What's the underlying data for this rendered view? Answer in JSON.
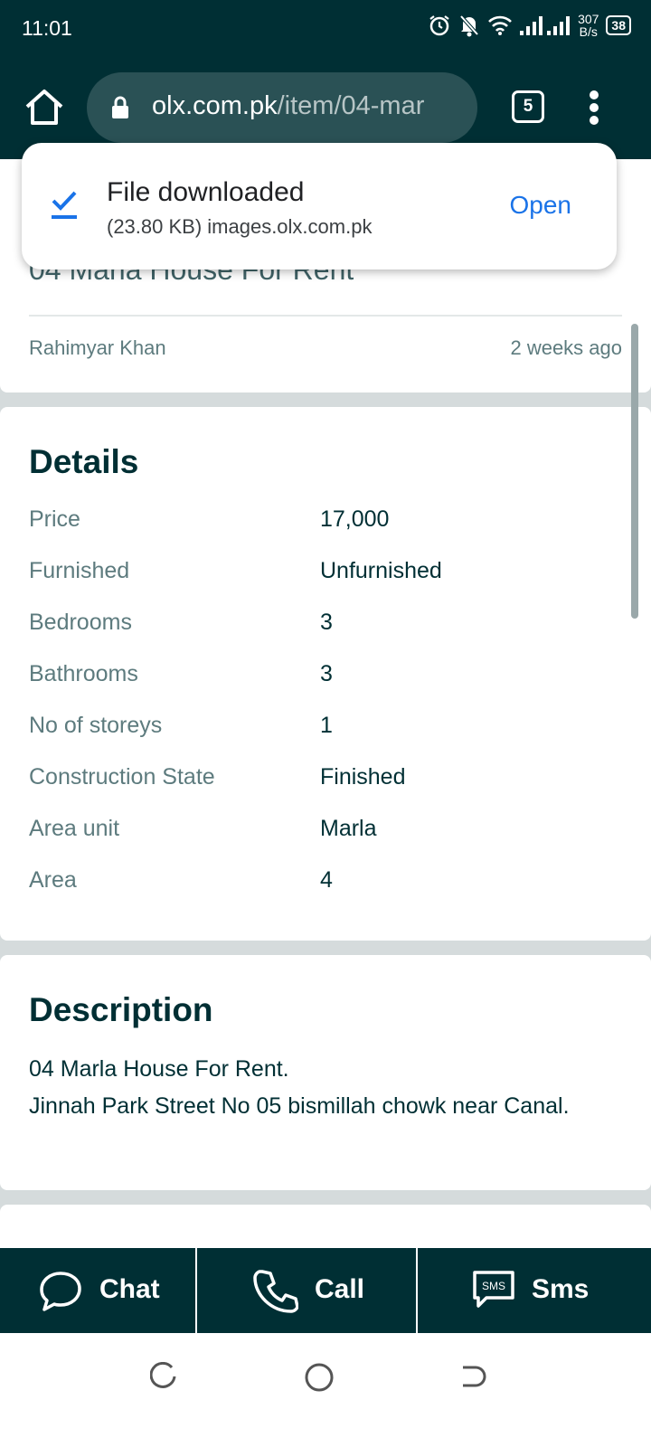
{
  "status_bar": {
    "time": "11:01",
    "net_speed_value": "307",
    "net_speed_unit": "B/s",
    "battery": "38"
  },
  "browser": {
    "url_domain": "olx.com.pk",
    "url_path": "/item/04-mar",
    "tab_count": "5"
  },
  "download": {
    "title": "File downloaded",
    "detail": "(23.80 KB) images.olx.com.pk",
    "open_label": "Open"
  },
  "ad": {
    "title": "04 Marla House For Rent",
    "location": "Rahimyar Khan",
    "posted": "2 weeks ago"
  },
  "details": {
    "heading": "Details",
    "rows": [
      {
        "label": "Price",
        "value": "17,000"
      },
      {
        "label": "Furnished",
        "value": "Unfurnished"
      },
      {
        "label": "Bedrooms",
        "value": "3"
      },
      {
        "label": "Bathrooms",
        "value": "3"
      },
      {
        "label": "No of storeys",
        "value": "1"
      },
      {
        "label": "Construction State",
        "value": "Finished"
      },
      {
        "label": "Area unit",
        "value": "Marla"
      },
      {
        "label": "Area",
        "value": "4"
      }
    ]
  },
  "description": {
    "heading": "Description",
    "line1": "04 Marla House For Rent.",
    "line2": "Jinnah Park Street No 05 bismillah chowk near Canal."
  },
  "actions": {
    "chat": "Chat",
    "call": "Call",
    "sms": "Sms",
    "sms_icon_text": "SMS"
  },
  "icons": [
    "alarm-icon",
    "mute-icon",
    "wifi-icon",
    "signal-icon",
    "home-icon",
    "lock-icon",
    "menu-icon",
    "download-check-icon",
    "chat-icon",
    "phone-icon",
    "sms-icon"
  ],
  "colors": {
    "brand_dark": "#002f34",
    "link_blue": "#1a73e8",
    "muted_text": "#5d7b7e"
  }
}
